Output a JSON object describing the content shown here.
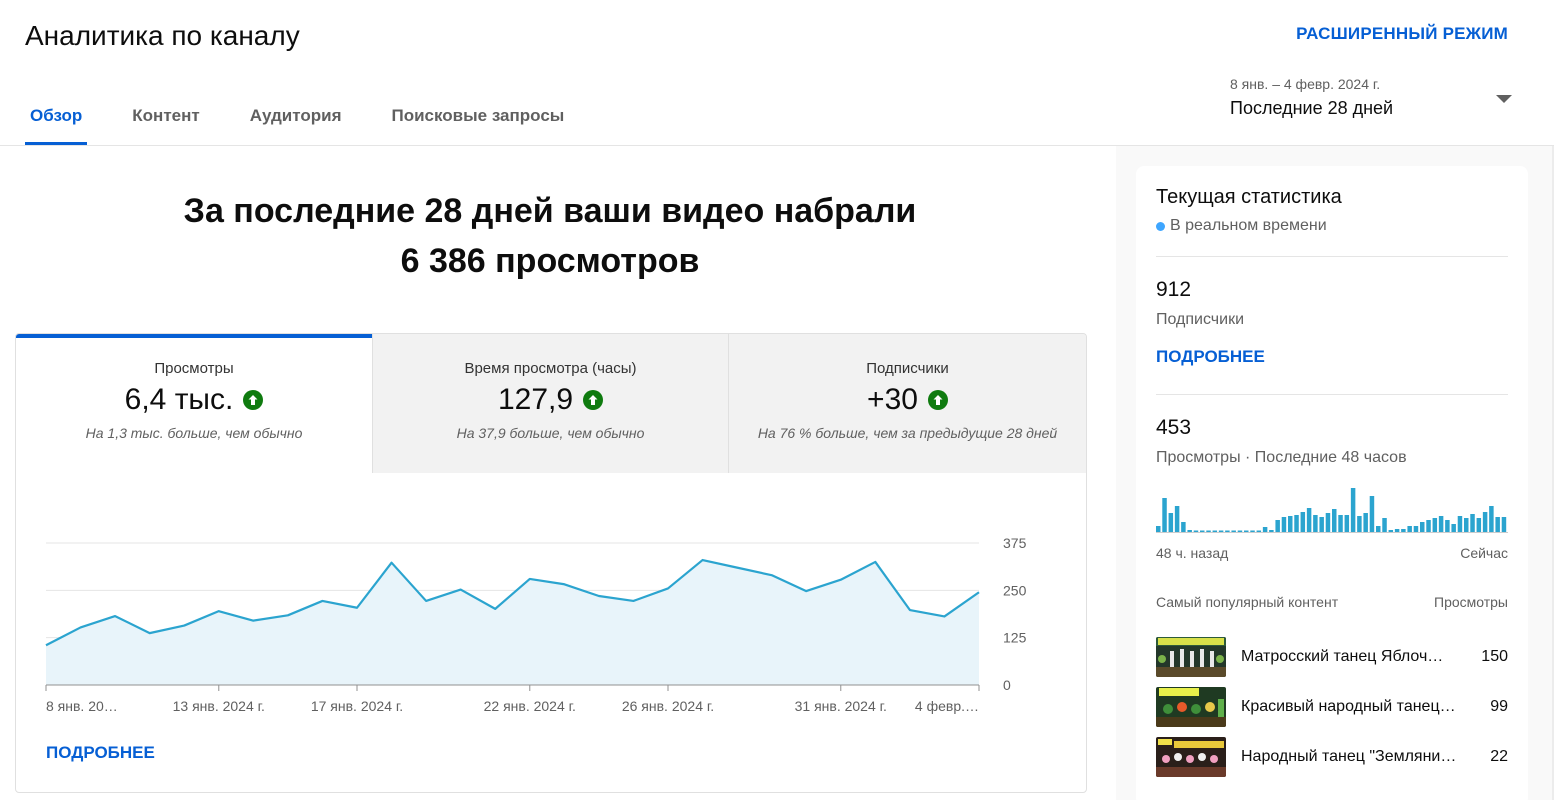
{
  "header": {
    "title": "Аналитика по каналу",
    "advanced_mode": "РАСШИРЕННЫЙ РЕЖИМ",
    "tabs": [
      {
        "label": "Обзор",
        "active": true
      },
      {
        "label": "Контент",
        "active": false
      },
      {
        "label": "Аудитория",
        "active": false
      },
      {
        "label": "Поисковые запросы",
        "active": false
      }
    ],
    "date_range": "8 янв. – 4 февр. 2024 г.",
    "period_label": "Последние 28 дней"
  },
  "summary": {
    "line1": "За последние 28 дней ваши видео набрали",
    "line2": "6 386 просмотров"
  },
  "metrics": [
    {
      "label": "Просмотры",
      "value": "6,4 тыс.",
      "note": "На 1,3 тыс. больше, чем обычно",
      "trend": "up"
    },
    {
      "label": "Время просмотра (часы)",
      "value": "127,9",
      "note": "На 37,9 больше, чем обычно",
      "trend": "up"
    },
    {
      "label": "Подписчики",
      "value": "+30",
      "note": "На 76 % больше, чем за предыдущие 28 дней",
      "trend": "up"
    }
  ],
  "chart_data": {
    "type": "area",
    "x": [
      "2024-01-08",
      "2024-01-09",
      "2024-01-10",
      "2024-01-11",
      "2024-01-12",
      "2024-01-13",
      "2024-01-14",
      "2024-01-15",
      "2024-01-16",
      "2024-01-17",
      "2024-01-18",
      "2024-01-19",
      "2024-01-20",
      "2024-01-21",
      "2024-01-22",
      "2024-01-23",
      "2024-01-24",
      "2024-01-25",
      "2024-01-26",
      "2024-01-27",
      "2024-01-28",
      "2024-01-29",
      "2024-01-30",
      "2024-01-31",
      "2024-02-01",
      "2024-02-02",
      "2024-02-03",
      "2024-02-04"
    ],
    "series": [
      {
        "values": [
          105,
          152,
          182,
          137,
          157,
          195,
          170,
          184,
          222,
          204,
          323,
          222,
          252,
          201,
          280,
          266,
          235,
          222,
          255,
          330,
          310,
          290,
          248,
          278,
          325,
          198,
          181,
          245
        ]
      }
    ],
    "x_tick_labels": [
      "8 янв. 20…",
      "13 янв. 2024 г.",
      "17 янв. 2024 г.",
      "22 янв. 2024 г.",
      "26 янв. 2024 г.",
      "31 янв. 2024 г.",
      "4 февр.…"
    ],
    "y_ticks": [
      "375",
      "250",
      "125",
      "0"
    ],
    "ylim": [
      0,
      375
    ],
    "grid": true,
    "color": "#2ba4cf",
    "fill": "#e8f4fa"
  },
  "card_more": "ПОДРОБНЕЕ",
  "realtime": {
    "title": "Текущая статистика",
    "live": "В реальном времени",
    "subscribers": "912",
    "subscribers_label": "Подписчики",
    "more": "ПОДРОБНЕЕ",
    "views": "453",
    "views_label": "Просмотры · Последние 48 часов",
    "spark_values": [
      6,
      34,
      19,
      26,
      10,
      2,
      1,
      0,
      0,
      0,
      0,
      0,
      0,
      0,
      0,
      1,
      0,
      5,
      2,
      12,
      15,
      16,
      17,
      20,
      24,
      17,
      15,
      19,
      23,
      17,
      17,
      44,
      16,
      19,
      36,
      6,
      14,
      2,
      3,
      3,
      6,
      6,
      10,
      12,
      14,
      16,
      12,
      8,
      16,
      14,
      18,
      14,
      20,
      26,
      15,
      15
    ],
    "axis_left": "48 ч. назад",
    "axis_right": "Сейчас",
    "top_head_left": "Самый популярный контент",
    "top_head_right": "Просмотры",
    "top_videos": [
      {
        "title": "Матросский танец Яблоч…",
        "views": "150"
      },
      {
        "title": "Красивый народный танец…",
        "views": "99"
      },
      {
        "title": "Народный танец \"Земляни…",
        "views": "22"
      }
    ],
    "accent": "#065fd4"
  }
}
